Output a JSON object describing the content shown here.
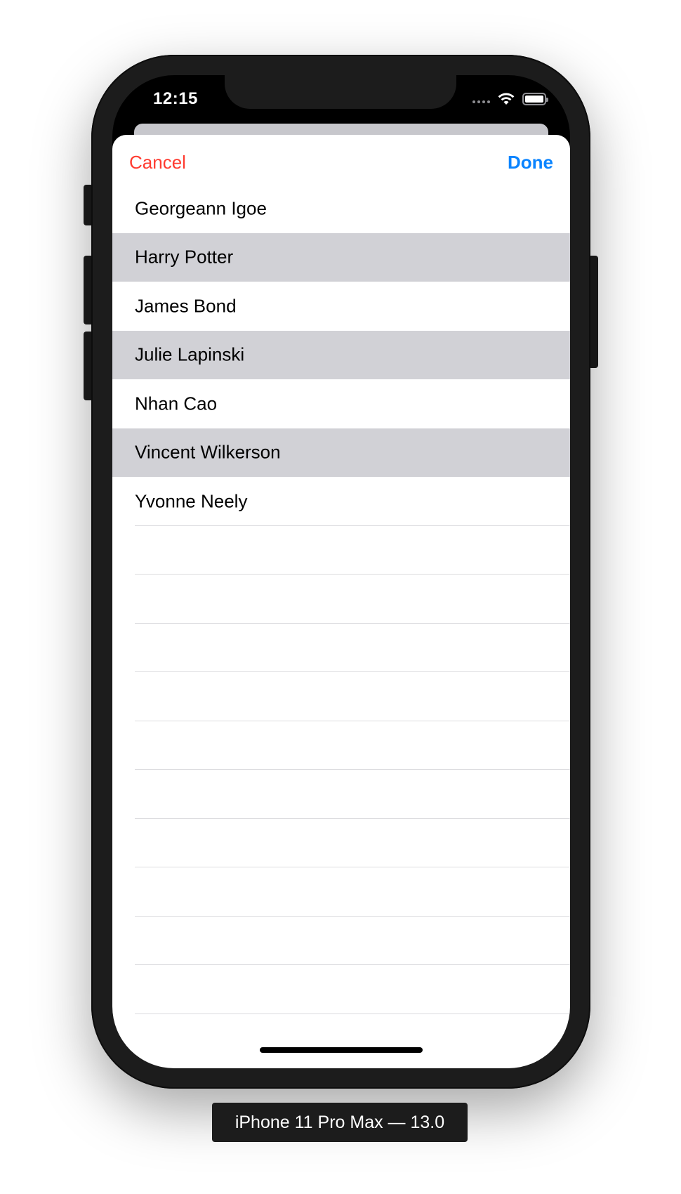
{
  "status_bar": {
    "time": "12:15"
  },
  "sheet": {
    "cancel_label": "Cancel",
    "done_label": "Done",
    "items": [
      "Georgeann Igoe",
      "Harry Potter",
      "James Bond",
      "Julie Lapinski",
      "Nhan Cao",
      "Vincent Wilkerson",
      "Yvonne Neely"
    ],
    "empty_rows": 10
  },
  "colors": {
    "cancel": "#ff3b30",
    "done": "#0a84ff",
    "stripe": "#d1d1d6"
  },
  "device_label": "iPhone 11 Pro Max — 13.0",
  "icons": {
    "signal": "cellular-signal-icon",
    "wifi": "wifi-icon",
    "battery": "battery-icon"
  }
}
